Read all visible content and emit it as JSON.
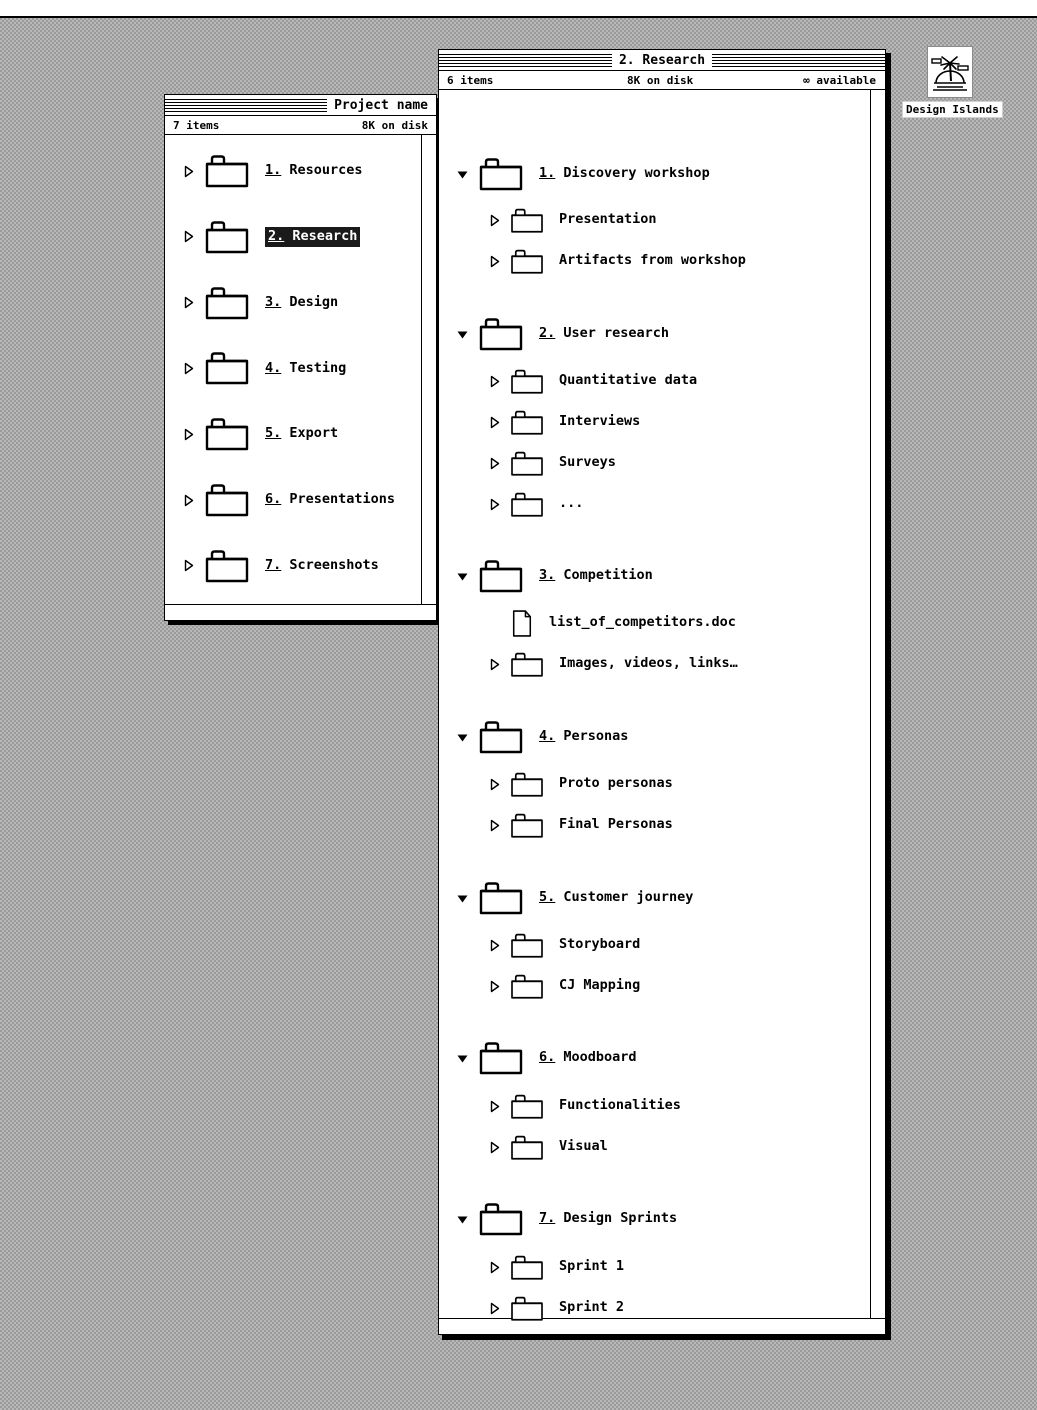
{
  "desktop": {
    "menubar": {
      "items": []
    },
    "disk_icon": {
      "name": "Design Islands",
      "icon": "island-palm-tree-icon"
    }
  },
  "windows": [
    {
      "id": "project-name-window",
      "title": "Project name",
      "info": {
        "items": "7 items",
        "size": "8K on disk",
        "available": ""
      },
      "rows": [
        {
          "num": "1.",
          "name": "Resources",
          "level": 0,
          "icon": "folder-icon",
          "state": "collapsed",
          "selected": false
        },
        {
          "num": "2.",
          "name": "Research",
          "level": 0,
          "icon": "folder-icon",
          "state": "collapsed",
          "selected": true
        },
        {
          "num": "3.",
          "name": "Design",
          "level": 0,
          "icon": "folder-icon",
          "state": "collapsed",
          "selected": false
        },
        {
          "num": "4.",
          "name": "Testing",
          "level": 0,
          "icon": "folder-icon",
          "state": "collapsed",
          "selected": false
        },
        {
          "num": "5.",
          "name": "Export",
          "level": 0,
          "icon": "folder-icon",
          "state": "collapsed",
          "selected": false
        },
        {
          "num": "6.",
          "name": "Presentations",
          "level": 0,
          "icon": "folder-icon",
          "state": "collapsed",
          "selected": false
        },
        {
          "num": "7.",
          "name": "Screenshots",
          "level": 0,
          "icon": "folder-icon",
          "state": "collapsed",
          "selected": false
        }
      ]
    },
    {
      "id": "research-window",
      "title": "2. Research",
      "info": {
        "items": "6 items",
        "size": "8K on disk",
        "available": "∞ available"
      },
      "rows": [
        {
          "num": "1.",
          "name": "Discovery workshop",
          "level": 0,
          "icon": "folder-icon",
          "state": "expanded",
          "selected": false
        },
        {
          "num": "",
          "name": "Presentation",
          "level": 1,
          "icon": "folder-icon",
          "state": "collapsed",
          "selected": false
        },
        {
          "num": "",
          "name": "Artifacts from workshop",
          "level": 1,
          "icon": "folder-icon",
          "state": "collapsed",
          "selected": false
        },
        {
          "num": "2.",
          "name": "User research",
          "level": 0,
          "icon": "folder-icon",
          "state": "expanded",
          "selected": false
        },
        {
          "num": "",
          "name": "Quantitative data",
          "level": 1,
          "icon": "folder-icon",
          "state": "collapsed",
          "selected": false
        },
        {
          "num": "",
          "name": "Interviews",
          "level": 1,
          "icon": "folder-icon",
          "state": "collapsed",
          "selected": false
        },
        {
          "num": "",
          "name": "Surveys",
          "level": 1,
          "icon": "folder-icon",
          "state": "collapsed",
          "selected": false
        },
        {
          "num": "",
          "name": "...",
          "level": 1,
          "icon": "folder-icon",
          "state": "collapsed",
          "selected": false
        },
        {
          "num": "3.",
          "name": "Competition",
          "level": 0,
          "icon": "folder-icon",
          "state": "expanded",
          "selected": false
        },
        {
          "num": "",
          "name": "list_of_competitors.doc",
          "level": 1,
          "icon": "document-icon",
          "state": "none",
          "selected": false
        },
        {
          "num": "",
          "name": "Images, videos, links…",
          "level": 1,
          "icon": "folder-icon",
          "state": "collapsed",
          "selected": false
        },
        {
          "num": "4.",
          "name": "Personas",
          "level": 0,
          "icon": "folder-icon",
          "state": "expanded",
          "selected": false
        },
        {
          "num": "",
          "name": "Proto personas",
          "level": 1,
          "icon": "folder-icon",
          "state": "collapsed",
          "selected": false
        },
        {
          "num": "",
          "name": "Final Personas",
          "level": 1,
          "icon": "folder-icon",
          "state": "collapsed",
          "selected": false
        },
        {
          "num": "5.",
          "name": "Customer journey",
          "level": 0,
          "icon": "folder-icon",
          "state": "expanded",
          "selected": false
        },
        {
          "num": "",
          "name": "Storyboard",
          "level": 1,
          "icon": "folder-icon",
          "state": "collapsed",
          "selected": false
        },
        {
          "num": "",
          "name": "CJ Mapping",
          "level": 1,
          "icon": "folder-icon",
          "state": "collapsed",
          "selected": false
        },
        {
          "num": "6.",
          "name": "Moodboard",
          "level": 0,
          "icon": "folder-icon",
          "state": "expanded",
          "selected": false
        },
        {
          "num": "",
          "name": "Functionalities",
          "level": 1,
          "icon": "folder-icon",
          "state": "collapsed",
          "selected": false
        },
        {
          "num": "",
          "name": "Visual",
          "level": 1,
          "icon": "folder-icon",
          "state": "collapsed",
          "selected": false
        },
        {
          "num": "7.",
          "name": "Design Sprints",
          "level": 0,
          "icon": "folder-icon",
          "state": "expanded",
          "selected": false
        },
        {
          "num": "",
          "name": "Sprint 1",
          "level": 1,
          "icon": "folder-icon",
          "state": "collapsed",
          "selected": false
        },
        {
          "num": "",
          "name": "Sprint 2",
          "level": 1,
          "icon": "folder-icon",
          "state": "collapsed",
          "selected": false
        }
      ]
    }
  ],
  "colors": {
    "desktop": "#b8b8b8",
    "window_bg": "#ffffff",
    "ink": "#000000",
    "selection_bg": "#1a1a1a",
    "selection_fg": "#ffffff"
  }
}
